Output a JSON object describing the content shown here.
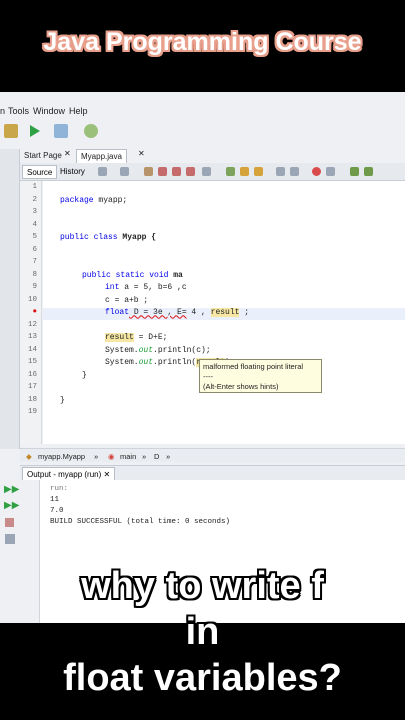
{
  "video": {
    "course_title": "Java Programming Course",
    "caption_lines": [
      "why to write f",
      "in",
      "float variables?"
    ]
  },
  "ide": {
    "menu": [
      "n",
      "Tools",
      "Window",
      "Help"
    ],
    "tabs": [
      "Start Page",
      "Myapp.java"
    ],
    "editor_tabs": [
      "Source",
      "History"
    ],
    "line_numbers": [
      "1",
      "2",
      "3",
      "4",
      "5",
      "6",
      "7",
      "8",
      "9",
      "10",
      "11",
      "12",
      "13",
      "14",
      "15",
      "16",
      "17",
      "18",
      "19"
    ],
    "code": {
      "l2a": "package",
      "l2b": " myapp;",
      "l5a": "public class",
      "l5b": " Myapp {",
      "l8a": "public static void",
      "l8b": " ma",
      "l9a": "int",
      "l9b": " a = 5, b=6 ,c",
      "l10": "c = a+b ;",
      "l11a": "float",
      "l11b": " D = 3e , E=",
      "l11c": " 4 , ",
      "l11d": "result",
      "l11e": " ;",
      "l13a": "result",
      "l13b": " = D+E;",
      "l14a": "System.",
      "l14b": "out",
      "l14c": ".println(c);",
      "l15a": "System.",
      "l15b": "out",
      "l15c": ".println(",
      "l15d": "result",
      "l15e": ");",
      "l16": "}",
      "l18": "}"
    },
    "tooltip": {
      "title": "malformed floating point literal",
      "sep": "----",
      "hint": "(Alt-Enter shows hints)"
    },
    "breadcrumb": [
      "myapp.Myapp",
      "main",
      "D"
    ],
    "output": {
      "tab_label": "Output - myapp (run)",
      "lines": [
        "run:",
        "11",
        "7.0",
        "BUILD SUCCESSFUL (total time: 0 seconds)"
      ]
    }
  },
  "colors": {
    "keyword": "#0000e6",
    "field": "#1b9b36",
    "highlight": "#f5e6a4",
    "error": "#e01010",
    "caption_outline": "#e8a08c"
  }
}
